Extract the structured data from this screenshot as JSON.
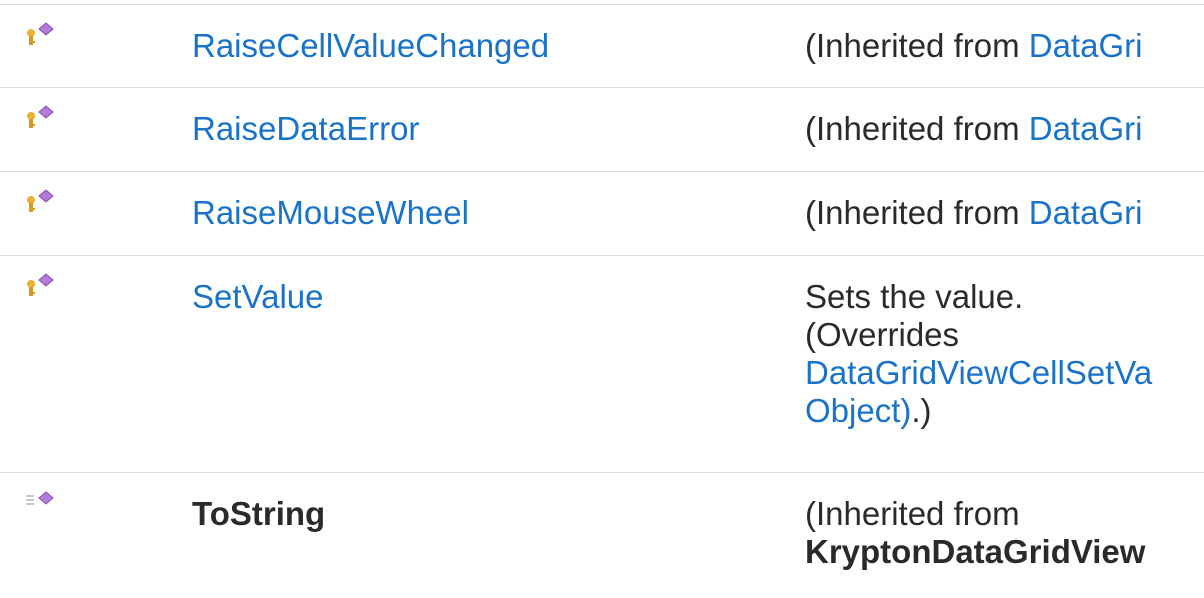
{
  "colors": {
    "link": "#1a73c9",
    "text": "#2a2a2a",
    "rule": "#dcdcdc",
    "icon_gem": "#b57ad6",
    "icon_key": "#e8b23a"
  },
  "rows": [
    {
      "icon": "protected-method-icon",
      "name": "RaiseCellValueChanged",
      "desc_prefix": "(Inherited from ",
      "desc_link": "DataGri"
    },
    {
      "icon": "protected-method-icon",
      "name": "RaiseDataError",
      "desc_prefix": "(Inherited from ",
      "desc_link": "DataGri"
    },
    {
      "icon": "protected-method-icon",
      "name": "RaiseMouseWheel",
      "desc_prefix": "(Inherited from ",
      "desc_link": "DataGri"
    },
    {
      "icon": "protected-method-icon",
      "name": "SetValue",
      "desc_line1": "Sets the value.",
      "desc_line2": "(Overrides",
      "desc_link1": "DataGridViewCellSetVa",
      "desc_link2": "Object)",
      "desc_suffix": ".)"
    },
    {
      "icon": "public-method-icon",
      "name": "ToString",
      "desc_line1": "(Inherited from",
      "desc_bold": "KryptonDataGridView"
    }
  ]
}
